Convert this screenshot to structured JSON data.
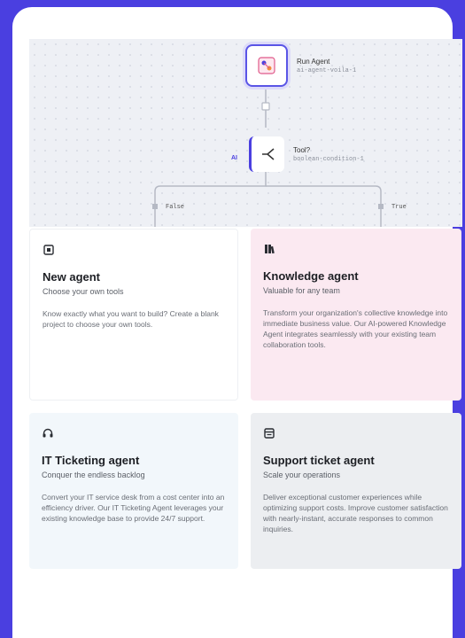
{
  "canvas": {
    "run_agent": {
      "title": "Run Agent",
      "subtitle": "ai-agent-voila-1"
    },
    "tool": {
      "title": "Tool?",
      "subtitle": "boolean-condition-1",
      "badge": "AI"
    },
    "branch_false": "False",
    "branch_true": "True"
  },
  "agents": [
    {
      "title": "New agent",
      "tagline": "Choose your own tools",
      "description": "Know exactly what you want to build? Create a blank project to choose your own tools.",
      "icon": "chip-icon"
    },
    {
      "title": "Knowledge agent",
      "tagline": "Valuable for any team",
      "description": "Transform your organization's collective knowledge into immediate business value. Our AI-powered Knowledge Agent integrates seamlessly with your existing team collaboration tools.",
      "icon": "books-icon"
    },
    {
      "title": "IT Ticketing agent",
      "tagline": "Conquer the endless backlog",
      "description": "Convert your IT service desk from a cost center into an efficiency driver. Our IT Ticketing Agent leverages your existing knowledge base to provide 24/7 support.",
      "icon": "headset-icon"
    },
    {
      "title": "Support ticket agent",
      "tagline": "Scale your operations",
      "description": "Deliver exceptional customer experiences while optimizing support costs. Improve customer satisfaction with nearly-instant, accurate responses to common inquiries.",
      "icon": "ticket-icon"
    }
  ],
  "colors": {
    "background": "#4a3fe0",
    "knowledge_tile": "#fbe9f1",
    "it_tile": "#f2f7fb",
    "support_tile": "#eceef1"
  }
}
